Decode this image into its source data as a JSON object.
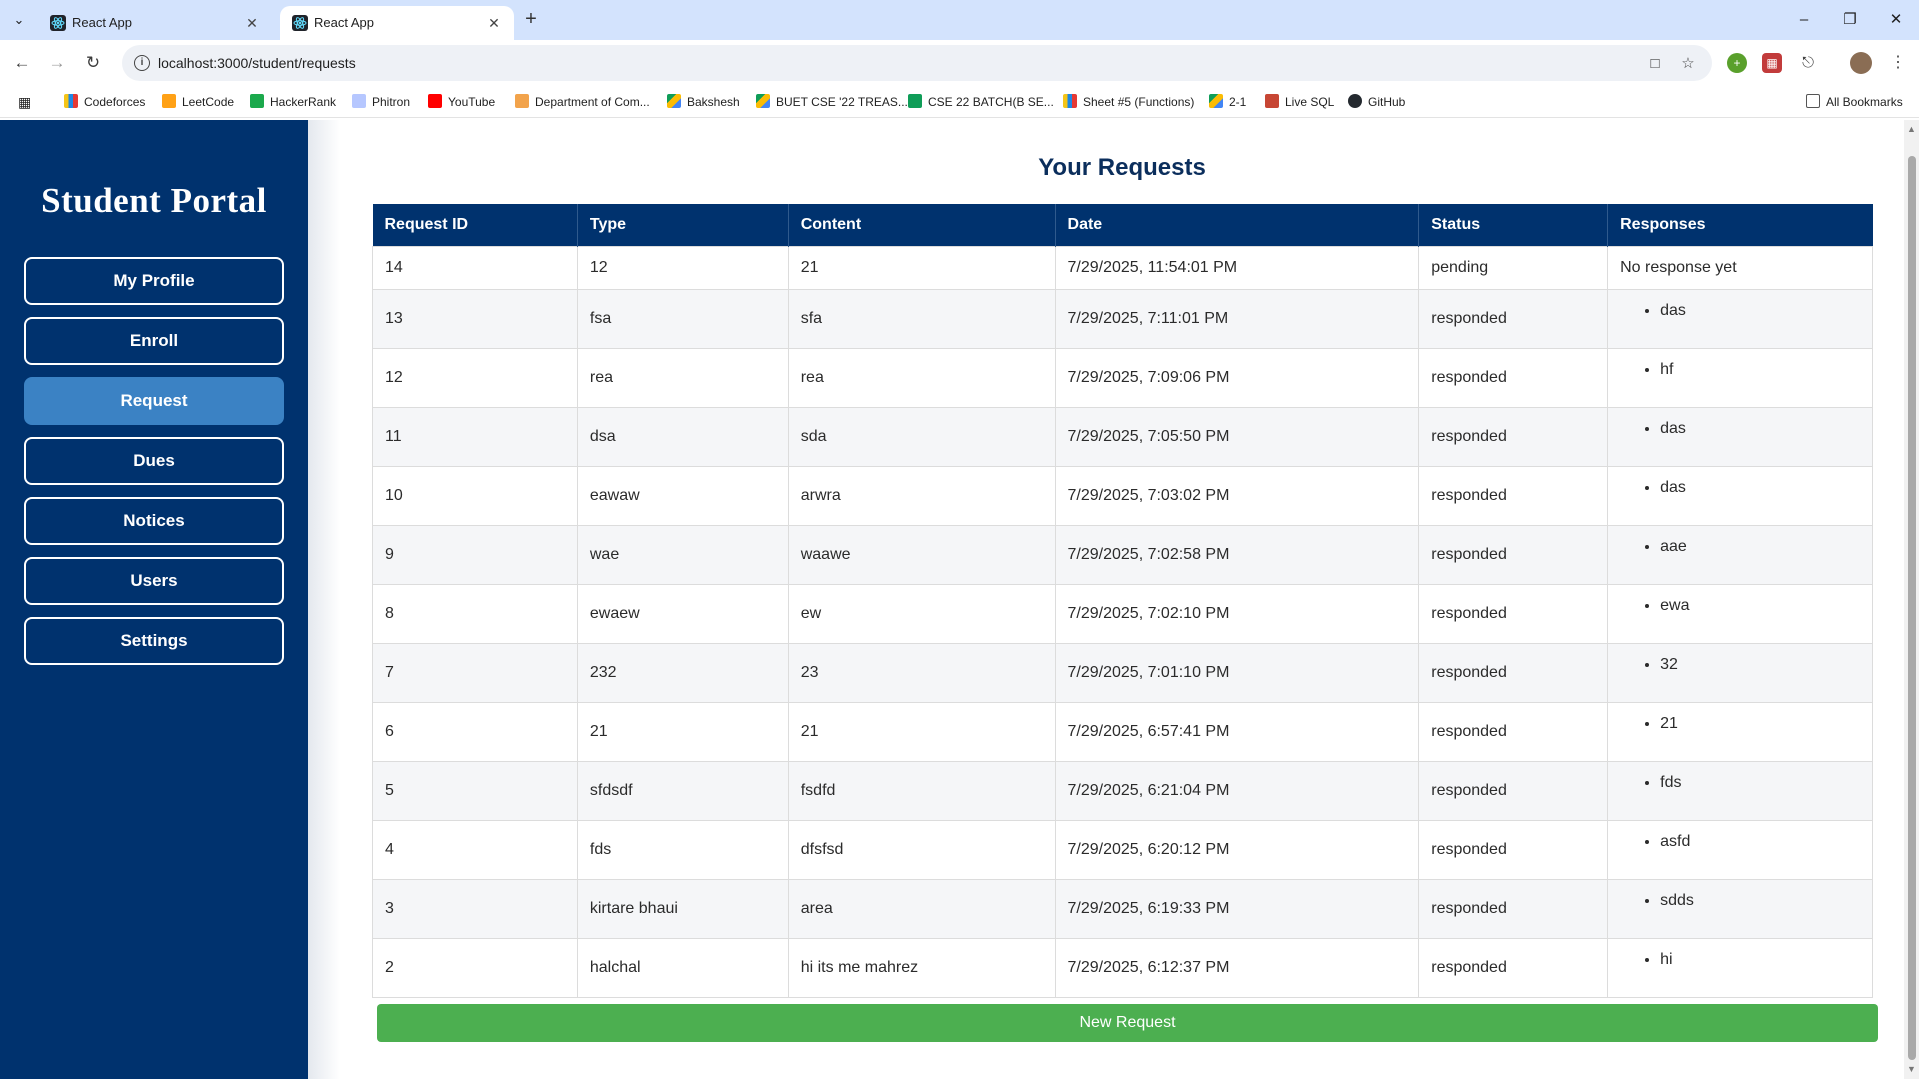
{
  "browser": {
    "tabs": [
      {
        "title": "React App",
        "active": false
      },
      {
        "title": "React App",
        "active": true
      }
    ],
    "url": "localhost:3000/student/requests",
    "bookmarks": [
      "Codeforces",
      "LeetCode",
      "HackerRank",
      "Phitron",
      "YouTube",
      "Department of Com...",
      "Bakshesh",
      "BUET CSE '22 TREAS...",
      "CSE 22 BATCH(B SE...",
      "Sheet #5 (Functions)",
      "2-1",
      "Live SQL",
      "GitHub"
    ],
    "all_bookmarks": "All Bookmarks"
  },
  "sidebar": {
    "brand": "Student Portal",
    "items": [
      {
        "label": "My Profile",
        "active": false
      },
      {
        "label": "Enroll",
        "active": false
      },
      {
        "label": "Request",
        "active": true
      },
      {
        "label": "Dues",
        "active": false
      },
      {
        "label": "Notices",
        "active": false
      },
      {
        "label": "Users",
        "active": false
      },
      {
        "label": "Settings",
        "active": false
      }
    ]
  },
  "main": {
    "title": "Your Requests",
    "columns": [
      "Request ID",
      "Type",
      "Content",
      "Date",
      "Status",
      "Responses"
    ],
    "rows": [
      {
        "id": "14",
        "type": "12",
        "content": "21",
        "date": "7/29/2025, 11:54:01 PM",
        "status": "pending",
        "response": "No response yet"
      },
      {
        "id": "13",
        "type": "fsa",
        "content": "sfa",
        "date": "7/29/2025, 7:11:01 PM",
        "status": "responded",
        "responses": [
          "das"
        ]
      },
      {
        "id": "12",
        "type": "rea",
        "content": "rea",
        "date": "7/29/2025, 7:09:06 PM",
        "status": "responded",
        "responses": [
          "hf"
        ]
      },
      {
        "id": "11",
        "type": "dsa",
        "content": "sda",
        "date": "7/29/2025, 7:05:50 PM",
        "status": "responded",
        "responses": [
          "das"
        ]
      },
      {
        "id": "10",
        "type": "eawaw",
        "content": "arwra",
        "date": "7/29/2025, 7:03:02 PM",
        "status": "responded",
        "responses": [
          "das"
        ]
      },
      {
        "id": "9",
        "type": "wae",
        "content": "waawe",
        "date": "7/29/2025, 7:02:58 PM",
        "status": "responded",
        "responses": [
          "aae"
        ]
      },
      {
        "id": "8",
        "type": "ewaew",
        "content": "ew",
        "date": "7/29/2025, 7:02:10 PM",
        "status": "responded",
        "responses": [
          "ewa"
        ]
      },
      {
        "id": "7",
        "type": "232",
        "content": "23",
        "date": "7/29/2025, 7:01:10 PM",
        "status": "responded",
        "responses": [
          "32"
        ]
      },
      {
        "id": "6",
        "type": "21",
        "content": "21",
        "date": "7/29/2025, 6:57:41 PM",
        "status": "responded",
        "responses": [
          "21"
        ]
      },
      {
        "id": "5",
        "type": "sfdsdf",
        "content": "fsdfd",
        "date": "7/29/2025, 6:21:04 PM",
        "status": "responded",
        "responses": [
          "fds"
        ]
      },
      {
        "id": "4",
        "type": "fds",
        "content": "dfsfsd",
        "date": "7/29/2025, 6:20:12 PM",
        "status": "responded",
        "responses": [
          "asfd"
        ]
      },
      {
        "id": "3",
        "type": "kirtare bhaui",
        "content": "area",
        "date": "7/29/2025, 6:19:33 PM",
        "status": "responded",
        "responses": [
          "sdds"
        ]
      },
      {
        "id": "2",
        "type": "halchal",
        "content": "hi its me mahrez",
        "date": "7/29/2025, 6:12:37 PM",
        "status": "responded",
        "responses": [
          "hi"
        ]
      }
    ],
    "new_request_label": "New Request"
  },
  "colors": {
    "sidebar_bg": "#00326e",
    "active_item": "#3b82c4",
    "table_header": "#00326e",
    "new_request": "#4caf50"
  }
}
